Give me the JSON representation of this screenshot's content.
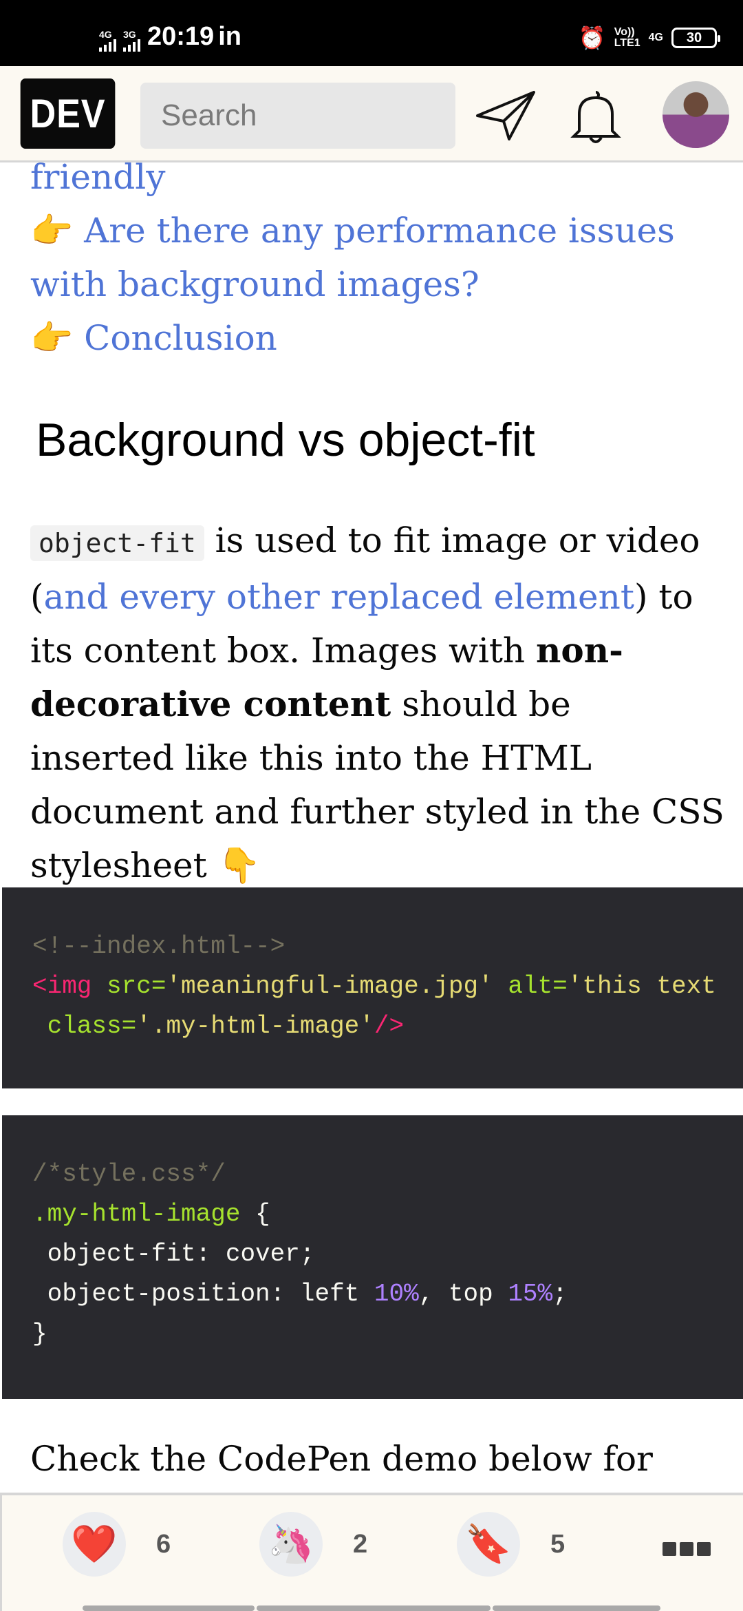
{
  "status_bar": {
    "sim1": "4G",
    "sim2": "3G",
    "time": "20:19",
    "carrier_suffix": "in",
    "volte": "Vo))",
    "lte": "LTE1",
    "network": "4G",
    "battery": "30"
  },
  "header": {
    "logo": "DEV",
    "search_placeholder": "Search",
    "icons": [
      "send-icon",
      "bell-icon",
      "avatar"
    ]
  },
  "toc": [
    {
      "emoji": "",
      "text": "friendly"
    },
    {
      "emoji": "👉",
      "text": "Are there any performance issues"
    },
    {
      "emoji": "",
      "text": "with background images?"
    },
    {
      "emoji": "👉",
      "text": "Conclusion"
    }
  ],
  "heading": "Background vs object-fit",
  "paragraph": {
    "code": "object-fit",
    "t1": " is used to fit image or video (",
    "link": "and every other replaced element",
    "t2": ") to its content box. Images with ",
    "bold": "non-decorative content",
    "t3": " should be inserted like this into the HTML document and further styled in the CSS stylesheet ",
    "emoji": "👇"
  },
  "code1": {
    "comment": "<!--index.html-->",
    "tag_open": "<img",
    "attr1": " src=",
    "val1": "'meaningful-image.jpg'",
    "attr2": " alt=",
    "val2": "'this text",
    "attr3": " class=",
    "val3": "'.my-html-image'",
    "tag_close": "/>"
  },
  "code2": {
    "comment": "/*style.css*/",
    "selector": ".my-html-image",
    "brace_open": " {",
    "line1": " object-fit: cover;",
    "line2a": " object-position: left ",
    "num1": "10%",
    "line2b": ", top ",
    "num2": "15%",
    "line2c": ";",
    "brace_close": "}"
  },
  "check_text": "Check the CodePen demo below for",
  "reactions": [
    {
      "icon": "heart-icon",
      "emoji": "❤️",
      "count": "6"
    },
    {
      "icon": "unicorn-icon",
      "emoji": "🦄",
      "count": "2"
    },
    {
      "icon": "bookmark-icon",
      "emoji": "🔖",
      "count": "5"
    }
  ],
  "colors": {
    "link": "#4f74d6",
    "code_bg": "#29292e",
    "header_bg": "#fcf9f2"
  }
}
